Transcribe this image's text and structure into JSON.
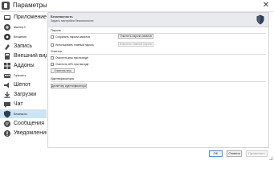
{
  "window": {
    "title": "Параметры",
    "close_glyph": "✕"
  },
  "sidebar": {
    "items": [
      {
        "label": "Приложение",
        "icon": "app-icon",
        "size": "lg"
      },
      {
        "label": "Мастер.З",
        "icon": "wizard-icon",
        "size": "sm"
      },
      {
        "label": "Вложения",
        "icon": "attachment-icon",
        "size": "sm"
      },
      {
        "label": "Запись",
        "icon": "record-icon",
        "size": "lg"
      },
      {
        "label": "Внешний вид",
        "icon": "appearance-icon",
        "size": "lg"
      },
      {
        "label": "Аддоны",
        "icon": "addons-icon",
        "size": "lg"
      },
      {
        "label": "Горячие к",
        "icon": "hotkeys-icon",
        "size": "sm"
      },
      {
        "label": "Шепот",
        "icon": "whisper-icon",
        "size": "lg"
      },
      {
        "label": "Загрузки",
        "icon": "downloads-icon",
        "size": "lg"
      },
      {
        "label": "Чат",
        "icon": "chat-icon",
        "size": "lg"
      },
      {
        "label": "Безопасно",
        "icon": "shield-icon",
        "size": "sm",
        "selected": true
      },
      {
        "label": "Сообщения",
        "icon": "messages-icon",
        "size": "lg"
      },
      {
        "label": "Уведомления",
        "icon": "notifications-icon",
        "size": "lg"
      }
    ]
  },
  "header": {
    "title": "Безопасность",
    "subtitle": "Задать настройки безопасности"
  },
  "passwords": {
    "section": "Пароли",
    "save_channel_passwords": "Сохранять пароли каналов",
    "use_master_password": "Использовать главный пароль",
    "clear_channel_passwords_button": "Очистить пароли каналов",
    "change_master_password_button": "Изменить главный пароль"
  },
  "cleanup": {
    "section": "Очистка",
    "clear_on_exit": "Очистить кеш при выходе",
    "clear_url_on_exit": "Очистить URL при выходе",
    "clear_cache_button": "Очистить кеш"
  },
  "identities": {
    "section": "Идентификаторы",
    "manager_button": "Диспетчер идентификаторов"
  },
  "footer": {
    "ok": "OK",
    "cancel": "Отмена",
    "apply": "Применить"
  },
  "colors": {
    "selection": "#cde4f7",
    "header_bg": "#e8eaed",
    "accent": "#4a90d9"
  }
}
